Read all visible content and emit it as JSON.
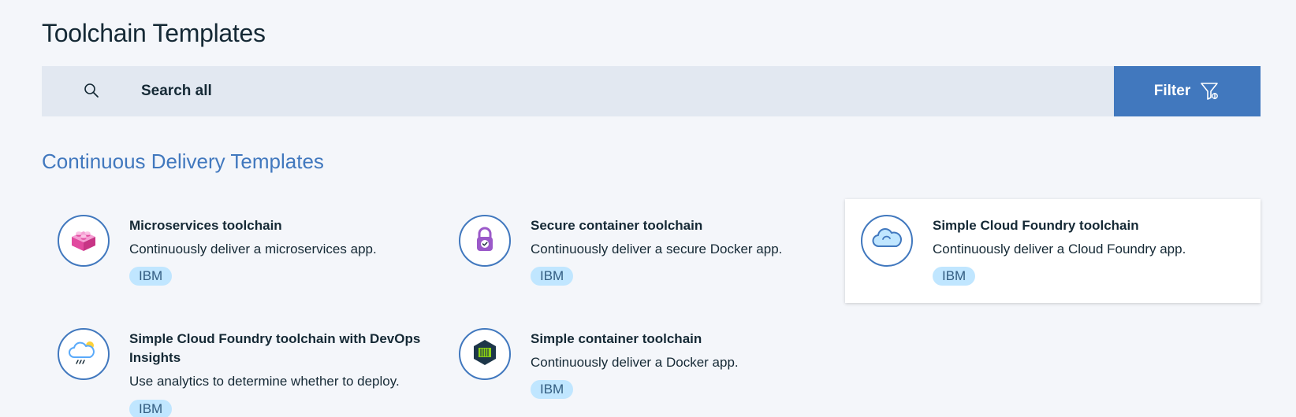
{
  "page": {
    "title": "Toolchain Templates"
  },
  "search": {
    "placeholder": "Search all",
    "icon": "search-icon"
  },
  "filter": {
    "label": "Filter",
    "icon": "filter-icon"
  },
  "section": {
    "title": "Continuous Delivery Templates"
  },
  "colors": {
    "accent": "#4178be",
    "badge_bg": "#c0e6ff",
    "badge_text": "#325c80",
    "search_bg": "#e2e8f1",
    "page_bg": "#f4f6fa"
  },
  "templates": [
    {
      "title": "Microservices toolchain",
      "description": "Continuously deliver a microservices app.",
      "badge": "IBM",
      "icon": "lego-block-icon"
    },
    {
      "title": "Secure container toolchain",
      "description": "Continuously deliver a secure Docker app.",
      "badge": "IBM",
      "icon": "padlock-icon"
    },
    {
      "title": "Simple Cloud Foundry toolchain",
      "description": "Continuously deliver a Cloud Foundry app.",
      "badge": "IBM",
      "icon": "cloud-icon",
      "selected": true
    },
    {
      "title": "Simple Cloud Foundry toolchain with DevOps Insights",
      "description": "Use analytics to determine whether to deploy.",
      "badge": "IBM",
      "icon": "cloud-sun-rain-icon"
    },
    {
      "title": "Simple container toolchain",
      "description": "Continuously deliver a Docker app.",
      "badge": "IBM",
      "icon": "container-hexagon-icon"
    }
  ]
}
